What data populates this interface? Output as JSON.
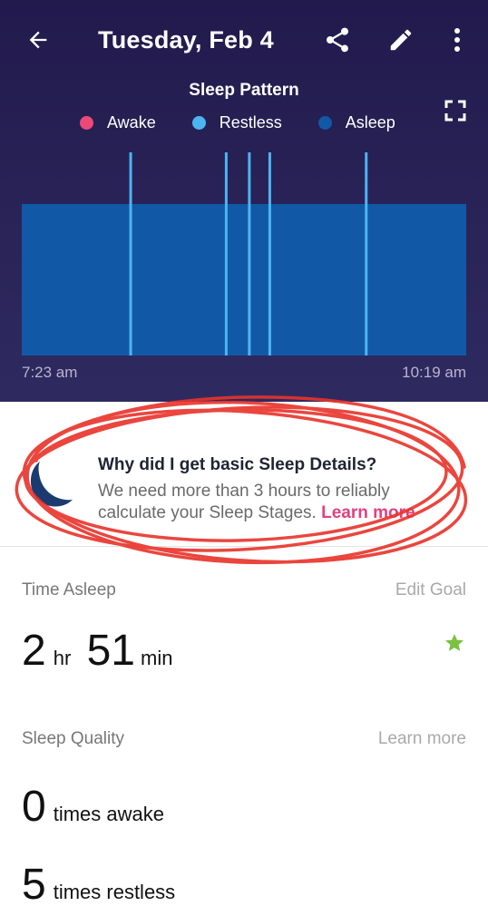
{
  "appbar": {
    "title": "Tuesday, Feb 4",
    "icons": [
      "back-arrow-icon",
      "share-icon",
      "edit-pencil-icon",
      "more-vert-icon"
    ]
  },
  "chart_data": {
    "type": "bar",
    "title": "Sleep Pattern",
    "legend": [
      {
        "label": "Awake",
        "color": "#ea4a77"
      },
      {
        "label": "Restless",
        "color": "#4db4f2"
      },
      {
        "label": "Asleep",
        "color": "#1159a6"
      }
    ],
    "x_start_label": "7:23 am",
    "x_end_label": "10:19 am",
    "restless_marks_fraction": [
      0.245,
      0.46,
      0.512,
      0.558,
      0.775
    ],
    "asleep_level": 0.72
  },
  "info_card": {
    "title": "Why did I get basic Sleep Details?",
    "body": "We need more than 3 hours to reliably calculate your Sleep Stages.",
    "link": "Learn more"
  },
  "time_asleep": {
    "label": "Time Asleep",
    "action": "Edit Goal",
    "hours": "2",
    "hours_unit": "hr",
    "minutes": "51",
    "minutes_unit": "min"
  },
  "sleep_quality": {
    "label": "Sleep Quality",
    "action": "Learn more",
    "awake_count": "0",
    "awake_unit": "times awake",
    "restless_count": "5",
    "restless_unit": "times restless"
  },
  "colors": {
    "header_bg": "#2a2458",
    "awake": "#ea4a77",
    "restless": "#4db4f2",
    "asleep": "#1159a6",
    "link_pink": "#e3407f",
    "goal_star": "#7bc142",
    "annotation_red": "#e8332a"
  }
}
